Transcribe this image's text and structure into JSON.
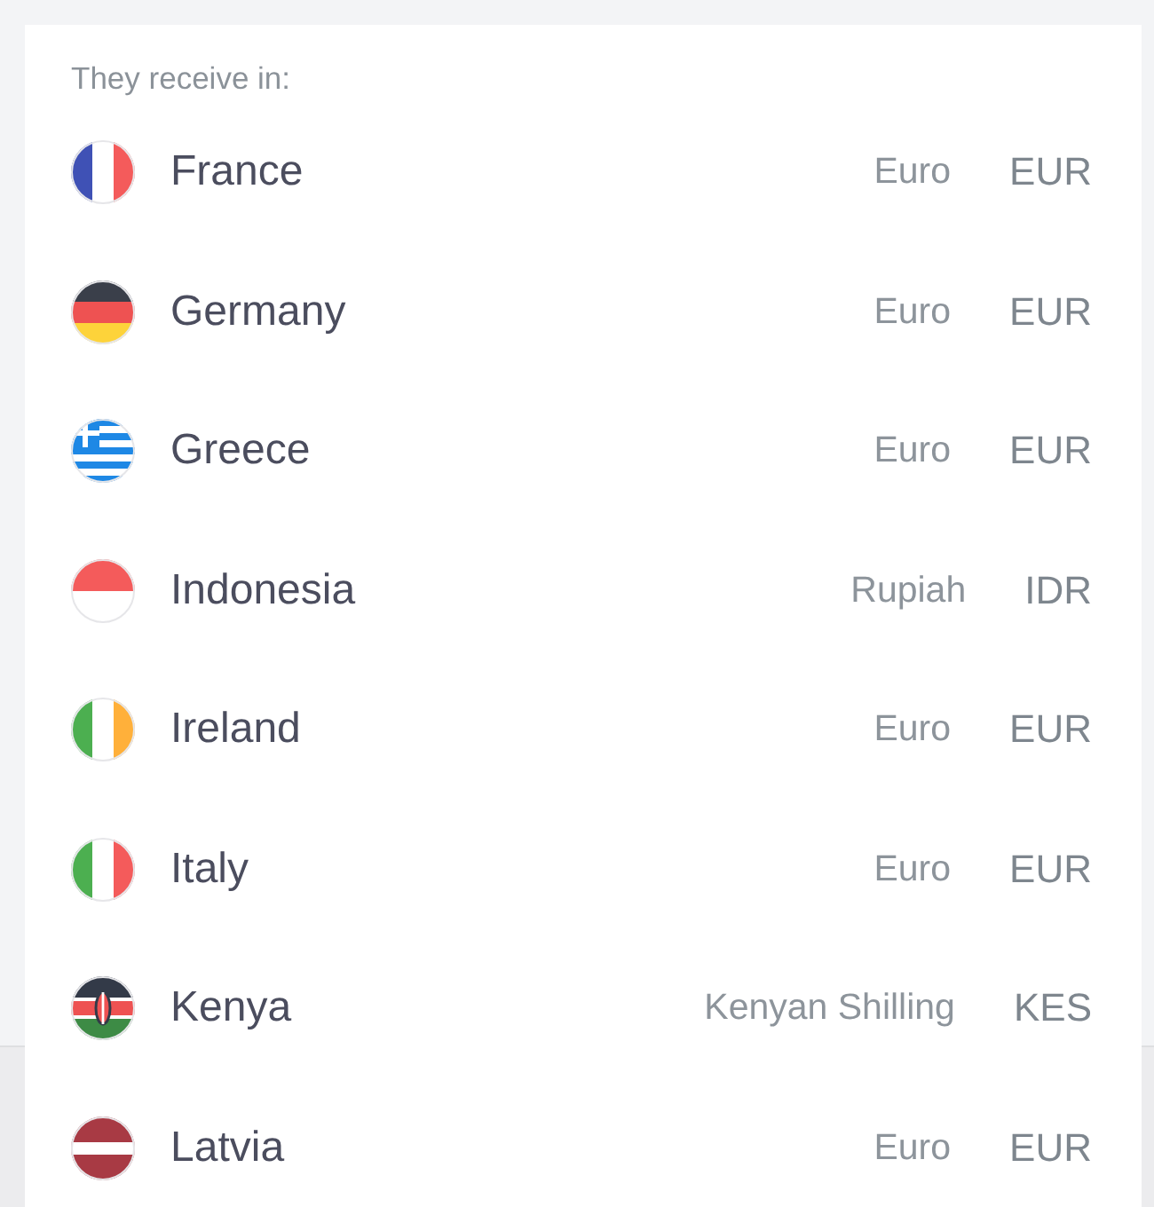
{
  "list_header": "They receive in:",
  "countries": [
    {
      "name": "France",
      "currency": "Euro",
      "code": "EUR"
    },
    {
      "name": "Germany",
      "currency": "Euro",
      "code": "EUR"
    },
    {
      "name": "Greece",
      "currency": "Euro",
      "code": "EUR"
    },
    {
      "name": "Indonesia",
      "currency": "Rupiah",
      "code": "IDR"
    },
    {
      "name": "Ireland",
      "currency": "Euro",
      "code": "EUR"
    },
    {
      "name": "Italy",
      "currency": "Euro",
      "code": "EUR"
    },
    {
      "name": "Kenya",
      "currency": "Kenyan Shilling",
      "code": "KES"
    },
    {
      "name": "Latvia",
      "currency": "Euro",
      "code": "EUR"
    }
  ]
}
